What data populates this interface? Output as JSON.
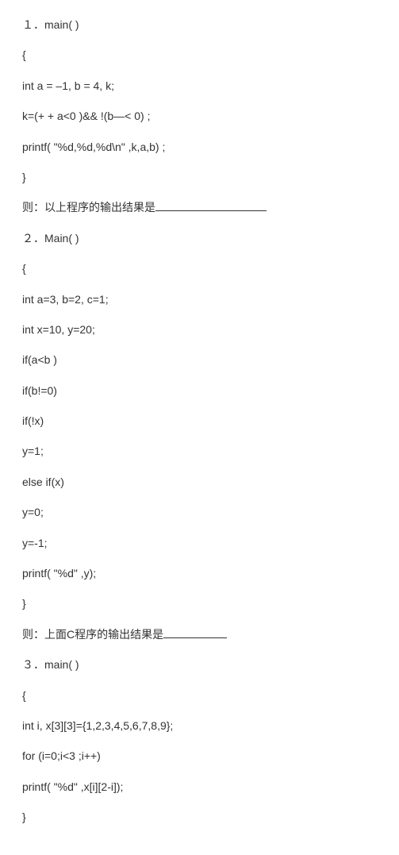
{
  "lines": [
    "１．main( )",
    "{",
    "int a = –1, b = 4, k;",
    "k=(+ + a<0 )&& !(b—< 0) ;",
    "printf( \"%d,%d,%d\\n\" ,k,a,b) ;",
    "}",
    "则：以上程序的输出结果是",
    "２．Main( )",
    "{",
    "int a=3, b=2, c=1;",
    "int x=10, y=20;",
    "if(a<b )",
    "if(b!=0)",
    "if(!x)",
    "y=1;",
    "else if(x)",
    "y=0;",
    "y=-1;",
    "printf( \"%d\" ,y);",
    "}",
    "则：上面C程序的输出结果是",
    "３．main( )",
    "{",
    "int i, x[3][3]={1,2,3,4,5,6,7,8,9};",
    "for (i=0;i<3 ;i++)",
    "printf( \"%d\" ,x[i][2-i]);",
    "}"
  ]
}
